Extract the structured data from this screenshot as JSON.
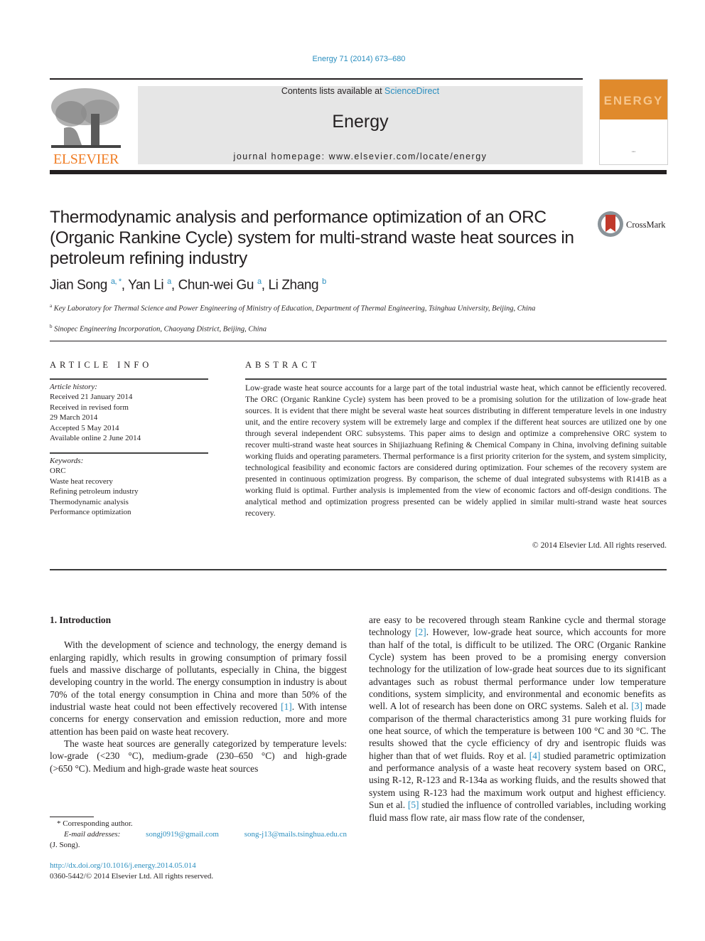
{
  "header": {
    "journal_ref": "Energy 71 (2014) 673–680",
    "contents_prefix": "Contents lists available at ",
    "contents_link": "ScienceDirect",
    "journal_name": "Energy",
    "homepage_label": "journal homepage: www.elsevier.com/locate/energy",
    "publisher_logo": "ELSEVIER",
    "cover_word": "ENERGY",
    "crossmark_label": "CrossMark",
    "colors": {
      "link": "#2a8ebf",
      "elsevier_orange": "#f07e26",
      "cover_orange": "#e08a2c",
      "header_bg": "#e6e6e6"
    }
  },
  "article": {
    "title": "Thermodynamic analysis and performance optimization of an ORC (Organic Rankine Cycle) system for multi-strand waste heat sources in petroleum refining industry",
    "authors": [
      {
        "name": "Jian Song",
        "sup": "a, *"
      },
      {
        "name": "Yan Li",
        "sup": "a"
      },
      {
        "name": "Chun-wei Gu",
        "sup": "a"
      },
      {
        "name": "Li Zhang",
        "sup": "b"
      }
    ],
    "affiliations": [
      {
        "mark": "a",
        "text": "Key Laboratory for Thermal Science and Power Engineering of Ministry of Education, Department of Thermal Engineering, Tsinghua University, Beijing, China"
      },
      {
        "mark": "b",
        "text": "Sinopec Engineering Incorporation, Chaoyang District, Beijing, China"
      }
    ]
  },
  "article_info": {
    "heading": "ARTICLE INFO",
    "history_label": "Article history:",
    "history": [
      "Received 21 January 2014",
      "Received in revised form",
      "29 March 2014",
      "Accepted 5 May 2014",
      "Available online 2 June 2014"
    ],
    "keywords_label": "Keywords:",
    "keywords": [
      "ORC",
      "Waste heat recovery",
      "Refining petroleum industry",
      "Thermodynamic analysis",
      "Performance optimization"
    ]
  },
  "abstract": {
    "heading": "ABSTRACT",
    "text": "Low-grade waste heat source accounts for a large part of the total industrial waste heat, which cannot be efficiently recovered. The ORC (Organic Rankine Cycle) system has been proved to be a promising solution for the utilization of low-grade heat sources. It is evident that there might be several waste heat sources distributing in different temperature levels in one industry unit, and the entire recovery system will be extremely large and complex if the different heat sources are utilized one by one through several independent ORC subsystems. This paper aims to design and optimize a comprehensive ORC system to recover multi-strand waste heat sources in Shijiazhuang Refining & Chemical Company in China, involving defining suitable working fluids and operating parameters. Thermal performance is a first priority criterion for the system, and system simplicity, technological feasibility and economic factors are considered during optimization. Four schemes of the recovery system are presented in continuous optimization progress. By comparison, the scheme of dual integrated subsystems with R141B as a working fluid is optimal. Further analysis is implemented from the view of economic factors and off-design conditions. The analytical method and optimization progress presented can be widely applied in similar multi-strand waste heat sources recovery.",
    "copyright": "© 2014 Elsevier Ltd. All rights reserved."
  },
  "body": {
    "section_title": "1.  Introduction",
    "left_p1_a": "With the development of science and technology, the energy demand is enlarging rapidly, which results in growing consumption of primary fossil fuels and massive discharge of pollutants, especially in China, the biggest developing country in the world. The energy consumption in industry is about 70% of the total energy consumption in China and more than 50% of the industrial waste heat could not been effectively recovered ",
    "cite1": "[1]",
    "left_p1_b": ". With intense concerns for energy conservation and emission reduction, more and more attention has been paid on waste heat recovery.",
    "left_p2": "The waste heat sources are generally categorized by temperature levels: low-grade (<230 °C), medium-grade (230–650 °C) and high-grade (>650 °C). Medium and high-grade waste heat sources",
    "right_a": "are easy to be recovered through steam Rankine cycle and thermal storage technology ",
    "cite2": "[2]",
    "right_b": ". However, low-grade heat source, which accounts for more than half of the total, is difficult to be utilized. The ORC (Organic Rankine Cycle) system has been proved to be a promising energy conversion technology for the utilization of low-grade heat sources due to its significant advantages such as robust thermal performance under low temperature conditions, system simplicity, and environmental and economic benefits as well. A lot of research has been done on ORC systems. Saleh et al. ",
    "cite3": "[3]",
    "right_c": " made comparison of the thermal characteristics among 31 pure working fluids for one heat source, of which the temperature is between 100 °C and 30 °C. The results showed that the cycle efficiency of dry and isentropic fluids was higher than that of wet fluids. Roy et al. ",
    "cite4": "[4]",
    "right_d": " studied parametric optimization and performance analysis of a waste heat recovery system based on ORC, using R-12, R-123 and R-134a as working fluids, and the results showed that system using R-123 had the maximum work output and highest efficiency. Sun et al. ",
    "cite5": "[5]",
    "right_e": " studied the influence of controlled variables, including working fluid mass flow rate, air mass flow rate of the condenser,"
  },
  "footnote": {
    "corresponding": "* Corresponding author.",
    "email_label": "E-mail addresses:",
    "email1": "songj0919@gmail.com",
    "email2": "song-j13@mails.tsinghua.edu.cn",
    "email_owner": "(J. Song).",
    "doi": "http://dx.doi.org/10.1016/j.energy.2014.05.014",
    "issn": "0360-5442/© 2014 Elsevier Ltd. All rights reserved."
  }
}
